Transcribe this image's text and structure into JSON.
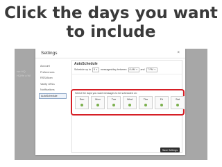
{
  "headline": {
    "line1": "Click the days you want",
    "line2": "to include"
  },
  "background": {
    "text1": "rse HQ",
    "text2": "HQHe a Wi"
  },
  "dialog": {
    "title": "Settings",
    "close_label": "×",
    "nav": [
      "Account",
      "Preferences",
      "RSS/Atom",
      "Vanity URLs",
      "Notifications",
      "AutoSchedule"
    ],
    "active_nav_index": 5
  },
  "autoschedule": {
    "heading": "AutoSchedule",
    "schedule_prefix": "Schedule up to",
    "count_value": "5",
    "between_text": "messages/day between",
    "start_value": "8 AM",
    "and_text": "and",
    "end_value": "7 PM",
    "days_caption": "Select the days you want messages to be scheduled on:",
    "days": [
      {
        "label": "Sun",
        "selected": true
      },
      {
        "label": "Mon",
        "selected": true
      },
      {
        "label": "Tue",
        "selected": true
      },
      {
        "label": "Wed",
        "selected": true
      },
      {
        "label": "Thu",
        "selected": true
      },
      {
        "label": "Fri",
        "selected": true
      },
      {
        "label": "Sat",
        "selected": true
      }
    ],
    "save_label": "Save Settings"
  },
  "colors": {
    "highlight": "#d61f26",
    "selected_dot": "#7bb04d",
    "button": "#2f2f2f"
  }
}
